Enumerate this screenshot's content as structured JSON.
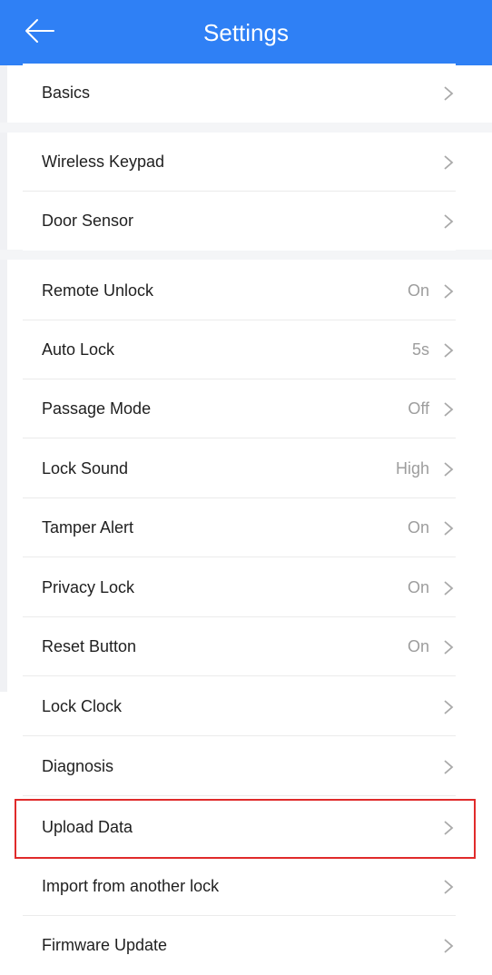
{
  "header": {
    "title": "Settings",
    "back_icon": "arrow-left-icon",
    "background": "#2f80f5"
  },
  "sections": [
    {
      "items": [
        {
          "label": "Basics",
          "value": ""
        }
      ]
    },
    {
      "items": [
        {
          "label": "Wireless Keypad",
          "value": ""
        },
        {
          "label": "Door Sensor",
          "value": ""
        }
      ]
    },
    {
      "items": [
        {
          "label": "Remote Unlock",
          "value": "On"
        },
        {
          "label": "Auto Lock",
          "value": "5s"
        },
        {
          "label": "Passage Mode",
          "value": "Off"
        },
        {
          "label": "Lock Sound",
          "value": "High"
        },
        {
          "label": "Tamper Alert",
          "value": "On"
        },
        {
          "label": "Privacy Lock",
          "value": "On"
        },
        {
          "label": "Reset Button",
          "value": "On"
        },
        {
          "label": "Lock Clock",
          "value": ""
        },
        {
          "label": "Diagnosis",
          "value": ""
        },
        {
          "label": "Upload Data",
          "value": "",
          "highlighted": true
        },
        {
          "label": "Import from another lock",
          "value": ""
        },
        {
          "label": "Firmware Update",
          "value": ""
        }
      ]
    }
  ],
  "chevron_icon": "chevron-right-icon",
  "highlight_color": "#e02b2b"
}
